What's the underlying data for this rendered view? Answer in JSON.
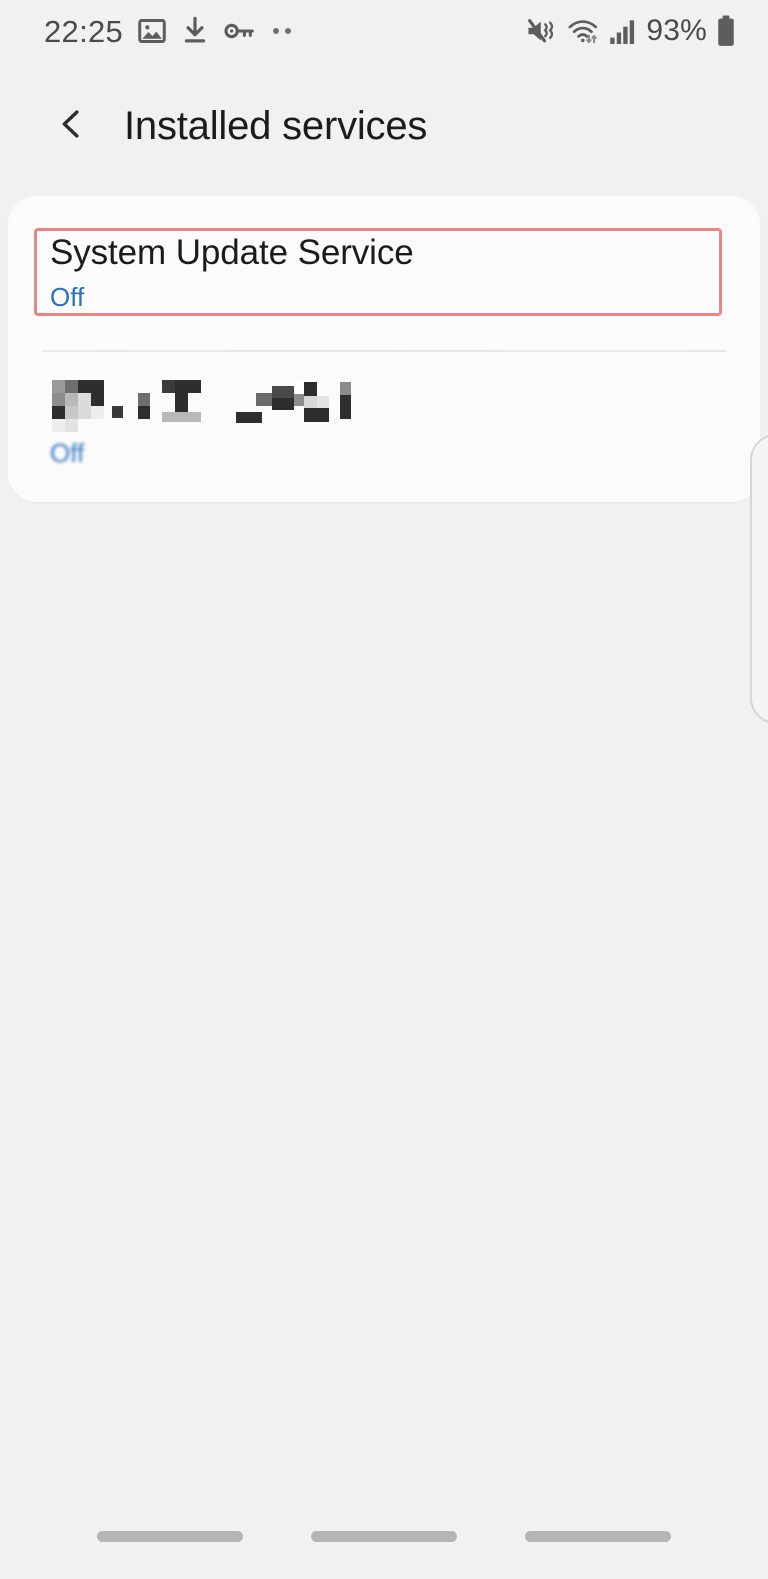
{
  "status_bar": {
    "time": "22:25",
    "battery_percent": "93%",
    "left_icons": [
      "gallery-image-icon",
      "download-icon",
      "key-vpn-icon",
      "more-dots-icon"
    ],
    "right_icons": [
      "mute-vibrate-icon",
      "wifi-transfer-icon",
      "signal-bars-icon",
      "battery-icon"
    ],
    "icon_color": "#5d5d5d"
  },
  "appbar": {
    "back_icon": "back-chevron-icon",
    "title": "Installed services"
  },
  "colors": {
    "background": "#f1f1f1",
    "card": "#fbfbfb",
    "title_text": "#1b1b1b",
    "status_blue": "#2a72bd",
    "highlight_red": "#ee8585",
    "divider": "#e8e8e8",
    "nav_pill": "#b5b5b5"
  },
  "services": {
    "items": [
      {
        "name": "System Update Service",
        "status": "Off",
        "highlighted": true,
        "redacted": false
      },
      {
        "name": "",
        "status": "Off",
        "highlighted": false,
        "redacted": true,
        "redaction_note": "pixelated-service-name"
      }
    ]
  },
  "edge_panel": {
    "name": "right-edge-panel"
  },
  "navbar": {
    "buttons": [
      "recents-pill",
      "home-pill",
      "back-pill"
    ]
  }
}
